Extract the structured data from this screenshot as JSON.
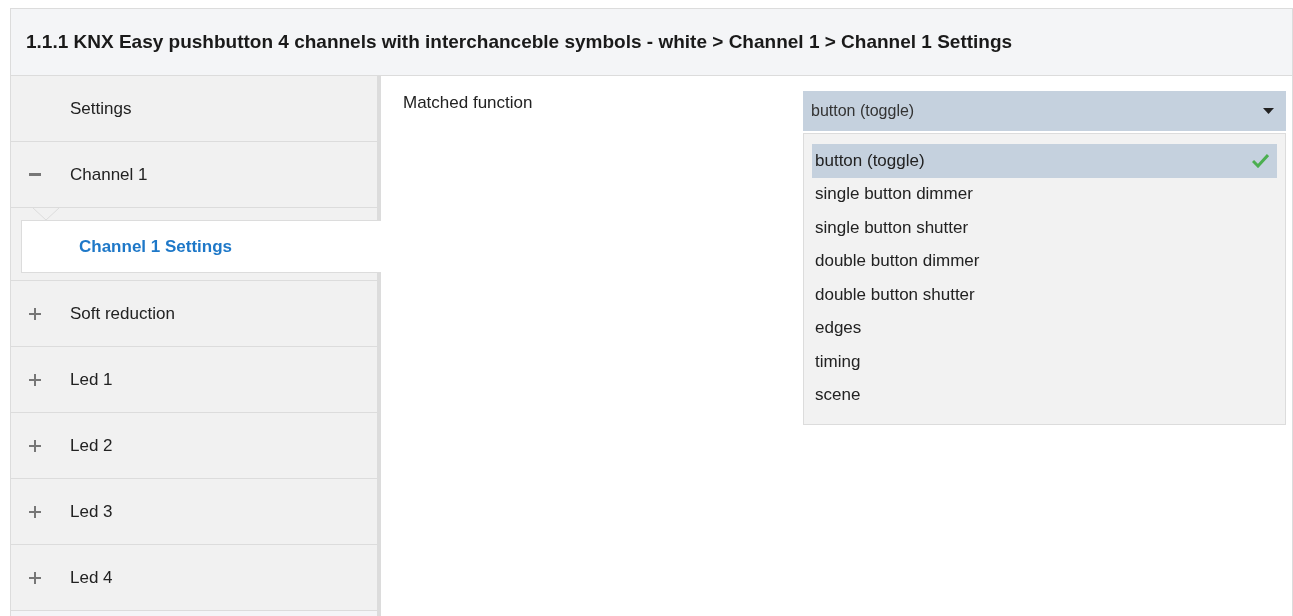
{
  "window": {
    "title": "1.1.1 KNX Easy pushbutton 4 channels with interchanceble symbols - white > Channel 1 > Channel 1 Settings"
  },
  "sidebar": {
    "items": [
      {
        "label": "Settings",
        "kind": "leaf",
        "selected": false
      },
      {
        "label": "Channel 1",
        "kind": "group",
        "expanded": true,
        "selected": false,
        "children": [
          {
            "label": "Channel 1 Settings",
            "selected": true
          }
        ]
      },
      {
        "label": "Soft reduction",
        "kind": "group",
        "expanded": false,
        "selected": false
      },
      {
        "label": "Led 1",
        "kind": "group",
        "expanded": false,
        "selected": false
      },
      {
        "label": "Led 2",
        "kind": "group",
        "expanded": false,
        "selected": false
      },
      {
        "label": "Led 3",
        "kind": "group",
        "expanded": false,
        "selected": false
      },
      {
        "label": "Led 4",
        "kind": "group",
        "expanded": false,
        "selected": false
      }
    ]
  },
  "parameter": {
    "label": "Matched function",
    "value": "button (toggle)",
    "options": [
      {
        "label": "button (toggle)",
        "selected": true
      },
      {
        "label": "single button dimmer",
        "selected": false
      },
      {
        "label": "single button shutter",
        "selected": false
      },
      {
        "label": "double button dimmer",
        "selected": false
      },
      {
        "label": "double button shutter",
        "selected": false
      },
      {
        "label": "edges",
        "selected": false
      },
      {
        "label": "timing",
        "selected": false
      },
      {
        "label": "scene",
        "selected": false
      }
    ]
  }
}
